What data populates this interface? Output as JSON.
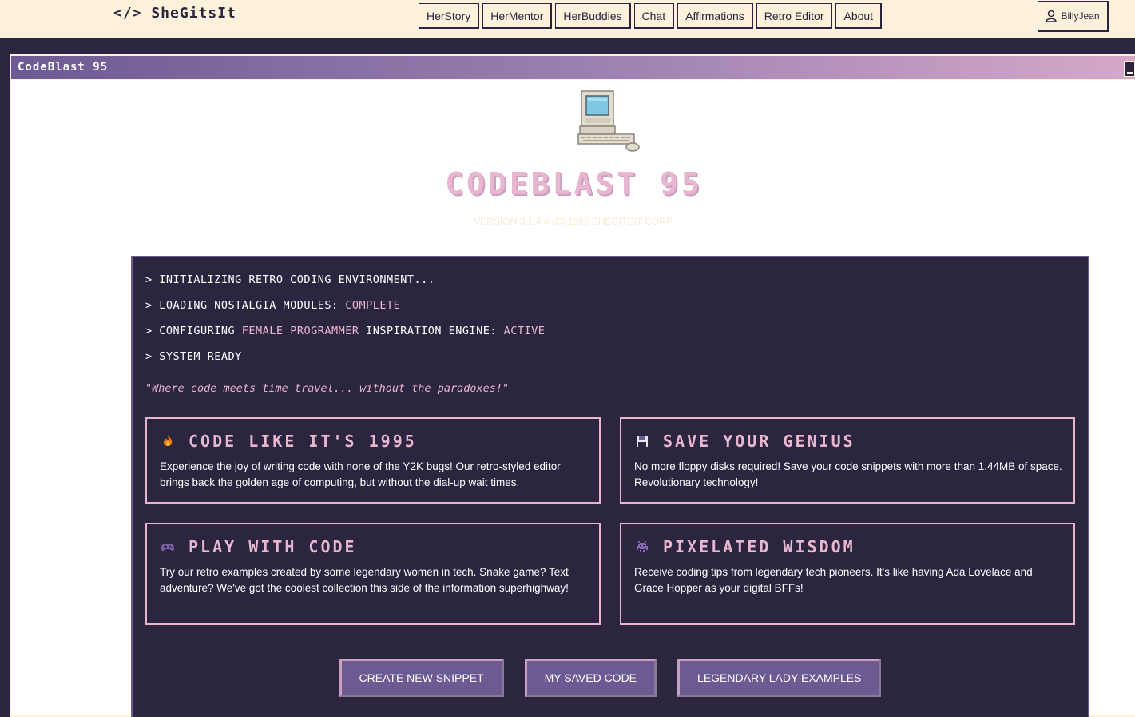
{
  "header": {
    "logo": "</> SheGitsIt",
    "nav": [
      "HerStory",
      "HerMentor",
      "HerBuddies",
      "Chat",
      "Affirmations",
      "Retro Editor",
      "About"
    ],
    "user": "BillyJean"
  },
  "window": {
    "title": "CodeBlast 95"
  },
  "hero": {
    "title": "CODEBLAST 95",
    "version": "VERSION 3.1.4 // (C) 1995 SHEGITSIT CORP."
  },
  "terminal": {
    "line1": "> INITIALIZING RETRO CODING ENVIRONMENT...",
    "line2_prefix": "> LOADING NOSTALGIA MODULES: ",
    "line2_status": "COMPLETE",
    "line3_prefix": "> CONFIGURING ",
    "line3_hl": "FEMALE PROGRAMMER",
    "line3_mid": " INSPIRATION ENGINE: ",
    "line3_status": "ACTIVE",
    "line4": "> SYSTEM READY",
    "quote": "\"Where code meets time travel... without the paradoxes!\""
  },
  "cards": [
    {
      "icon": "fire-icon",
      "title": "CODE LIKE IT'S 1995",
      "text": "Experience the joy of writing code with none of the Y2K bugs! Our retro-styled editor brings back the golden age of computing, but without the dial-up wait times."
    },
    {
      "icon": "floppy-disk-icon",
      "title": "SAVE YOUR GENIUS",
      "text": "No more floppy disks required! Save your code snippets with more than 1.44MB of space. Revolutionary technology!"
    },
    {
      "icon": "gamepad-icon",
      "title": "PLAY WITH CODE",
      "text": "Try our retro examples created by some legendary women in tech. Snake game? Text adventure? We've got the coolest collection this side of the information superhighway!"
    },
    {
      "icon": "space-invader-icon",
      "title": "PIXELATED WISDOM",
      "text": "Receive coding tips from legendary tech pioneers. It's like having Ada Lovelace and Grace Hopper as your digital BFFs!"
    }
  ],
  "actions": {
    "create": "CREATE NEW SNIPPET",
    "saved": "MY SAVED CODE",
    "examples": "LEGENDARY LADY EXAMPLES"
  },
  "colors": {
    "cream": "#fdf1dc",
    "dark_purple": "#2b2540",
    "pink": "#e8b6cf",
    "button_purple": "#6c5a92"
  }
}
